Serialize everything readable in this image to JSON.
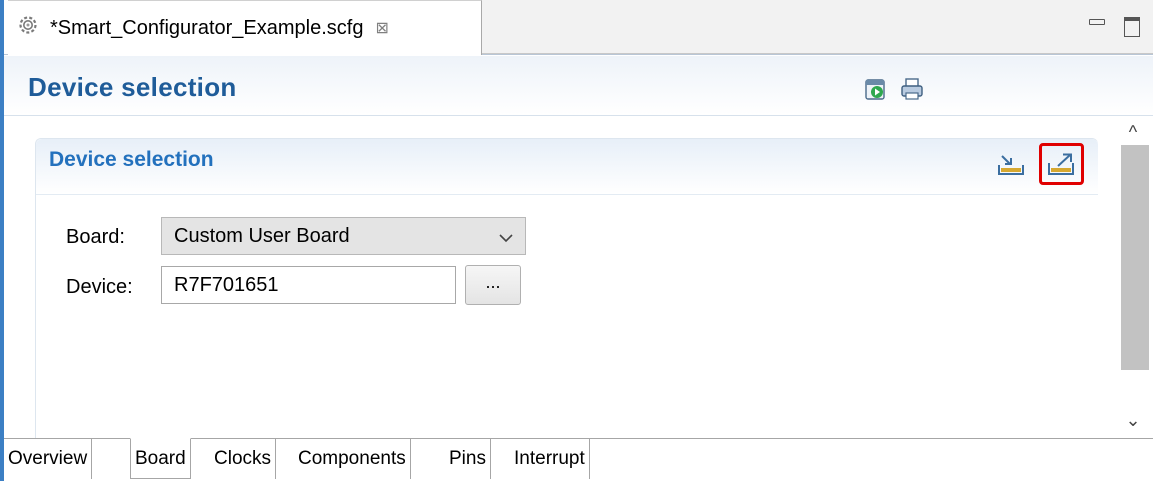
{
  "editor_tab": {
    "title": "*Smart_Configurator_Example.scfg",
    "close_glyph": "⊠",
    "icon": "gear-icon"
  },
  "window_controls": {
    "minimize_icon": "minimize-icon",
    "maximize_icon": "maximize-icon"
  },
  "form_header": {
    "title": "Device selection",
    "icons": [
      "run-icon",
      "print-icon"
    ]
  },
  "section": {
    "title": "Device selection",
    "icons": [
      "import-icon",
      "export-icon"
    ],
    "highlight_color": "#e00000"
  },
  "board": {
    "label": "Board:",
    "value": "Custom User Board"
  },
  "device": {
    "label": "Device:",
    "value": "R7F701651",
    "browse_label": "..."
  },
  "scrollbar": {
    "up_glyph": "^",
    "down_glyph": "⌄"
  },
  "page_tabs": [
    {
      "label": "Overview",
      "active": false
    },
    {
      "label": "Board",
      "active": true
    },
    {
      "label": "Clocks",
      "active": false
    },
    {
      "label": "Components",
      "active": false
    },
    {
      "label": "Pins",
      "active": false
    },
    {
      "label": "Interrupt",
      "active": false
    }
  ],
  "colors": {
    "title_blue": "#1f5c99",
    "section_blue": "#2371bd",
    "frame_blue": "#3c7fc4"
  }
}
